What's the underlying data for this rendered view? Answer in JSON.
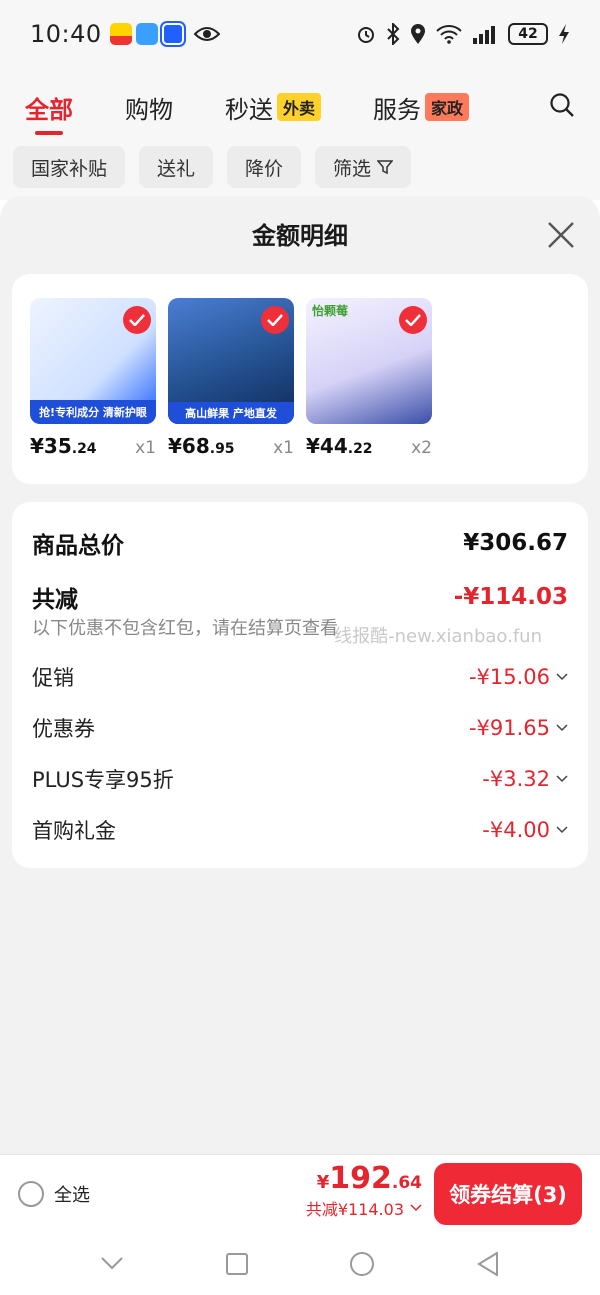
{
  "status_bar": {
    "time": "10:40",
    "app_badge": "运动",
    "battery": "42"
  },
  "nav": {
    "tabs": [
      {
        "label": "全部",
        "active": true
      },
      {
        "label": "购物"
      },
      {
        "label": "秒送",
        "badge": "外卖"
      },
      {
        "label": "服务",
        "badge": "家政"
      }
    ],
    "chips": [
      "国家补贴",
      "送礼",
      "降价",
      "筛选"
    ]
  },
  "sheet": {
    "title": "金额明细",
    "products": [
      {
        "price_int": "¥35",
        "price_dec": ".24",
        "qty": "x1",
        "img_text": "抢!专利成分 清新护眼"
      },
      {
        "price_int": "¥68",
        "price_dec": ".95",
        "qty": "x1",
        "img_text": "高山鲜果 产地直发"
      },
      {
        "price_int": "¥44",
        "price_dec": ".22",
        "qty": "x2",
        "img_text": "怡颗莓"
      }
    ],
    "summary": {
      "total_label": "商品总价",
      "total_value": "¥306.67",
      "discount_label": "共减",
      "discount_value": "-¥114.03",
      "note": "以下优惠不包含红包，请在结算页查看",
      "watermark": "线报酷-new.xianbao.fun",
      "items": [
        {
          "label": "促销",
          "value": "-¥15.06"
        },
        {
          "label": "优惠券",
          "value": "-¥91.65"
        },
        {
          "label": "PLUS专享95折",
          "value": "-¥3.32"
        },
        {
          "label": "首购礼金",
          "value": "-¥4.00"
        }
      ]
    }
  },
  "bottom": {
    "select_all": "全选",
    "price_symbol": "¥",
    "price_int": "192",
    "price_dec": ".64",
    "discount_text": "共减¥114.03",
    "checkout": "领券结算(3)"
  },
  "colors": {
    "accent": "#e4252d",
    "button": "#ef2a36"
  }
}
